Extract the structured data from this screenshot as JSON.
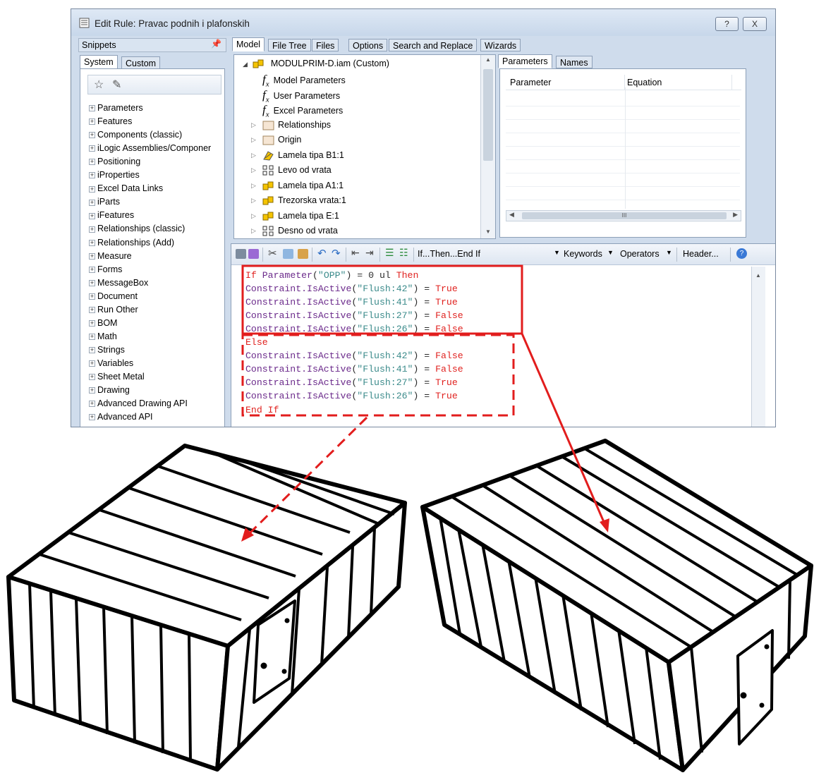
{
  "window": {
    "title": "Edit Rule: Pravac podnih i plafonskih",
    "help_label": "?",
    "close_label": "X"
  },
  "snippets": {
    "header": "Snippets",
    "pin": "ᵖ",
    "tabs": [
      "System",
      "Custom"
    ],
    "items": [
      "Parameters",
      "Features",
      "Components (classic)",
      "iLogic Assemblies/Componer",
      "Positioning",
      "iProperties",
      "Excel Data Links",
      "iParts",
      "iFeatures",
      "Relationships (classic)",
      "Relationships (Add)",
      "Measure",
      "Forms",
      "MessageBox",
      "Document",
      "Run Other",
      "BOM",
      "Math",
      "Strings",
      "Variables",
      "Sheet Metal",
      "Drawing",
      "Advanced Drawing API",
      "Advanced API"
    ]
  },
  "main_tabs": [
    "Model",
    "File Tree",
    "Files",
    "Options",
    "Search and Replace",
    "Wizards"
  ],
  "model_tree": {
    "root": "MODULPRIM-D.iam (Custom)",
    "items": [
      {
        "label": "Model Parameters",
        "icon": "fx-icon"
      },
      {
        "label": "User Parameters",
        "icon": "fx-icon"
      },
      {
        "label": "Excel Parameters",
        "icon": "fx-icon"
      },
      {
        "label": "Relationships",
        "icon": "folder-icon"
      },
      {
        "label": "Origin",
        "icon": "folder-icon"
      },
      {
        "label": "Lamela tipa B1:1",
        "icon": "part-icon"
      },
      {
        "label": "Levo od vrata",
        "icon": "pattern-icon"
      },
      {
        "label": "Lamela tipa A1:1",
        "icon": "assembly-icon"
      },
      {
        "label": "Trezorska vrata:1",
        "icon": "assembly-icon"
      },
      {
        "label": "Lamela tipa E:1",
        "icon": "assembly-icon"
      },
      {
        "label": "Desno od vrata",
        "icon": "pattern-icon"
      }
    ]
  },
  "param_tabs": [
    "Parameters",
    "Names"
  ],
  "param_columns": [
    "Parameter",
    "Equation"
  ],
  "param_scroll": "III",
  "toolbar": {
    "ifthen": "If...Then...End If",
    "keywords": "Keywords",
    "operators": "Operators",
    "header": "Header..."
  },
  "code_lines": [
    [
      [
        "kw",
        "If "
      ],
      [
        "fn",
        "Parameter"
      ],
      [
        "pl",
        "("
      ],
      [
        "str",
        "\"OPP\""
      ],
      [
        "pl",
        ") = 0 ul "
      ],
      [
        "kw",
        "Then"
      ]
    ],
    [
      [
        "fn",
        "Constraint.IsActive"
      ],
      [
        "pl",
        "("
      ],
      [
        "str",
        "\"Flush:42\""
      ],
      [
        "pl",
        ") = "
      ],
      [
        "kw",
        "True"
      ]
    ],
    [
      [
        "fn",
        "Constraint.IsActive"
      ],
      [
        "pl",
        "("
      ],
      [
        "str",
        "\"Flush:41\""
      ],
      [
        "pl",
        ") = "
      ],
      [
        "kw",
        "True"
      ]
    ],
    [
      [
        "fn",
        "Constraint.IsActive"
      ],
      [
        "pl",
        "("
      ],
      [
        "str",
        "\"Flush:27\""
      ],
      [
        "pl",
        ") = "
      ],
      [
        "kw",
        "False"
      ]
    ],
    [
      [
        "fn",
        "Constraint.IsActive"
      ],
      [
        "pl",
        "("
      ],
      [
        "str",
        "\"Flush:26\""
      ],
      [
        "pl",
        ") = "
      ],
      [
        "kw",
        "False"
      ]
    ],
    [
      [
        "kw",
        "Else"
      ]
    ],
    [
      [
        "fn",
        "Constraint.IsActive"
      ],
      [
        "pl",
        "("
      ],
      [
        "str",
        "\"Flush:42\""
      ],
      [
        "pl",
        ") = "
      ],
      [
        "kw",
        "False"
      ]
    ],
    [
      [
        "fn",
        "Constraint.IsActive"
      ],
      [
        "pl",
        "("
      ],
      [
        "str",
        "\"Flush:41\""
      ],
      [
        "pl",
        ") = "
      ],
      [
        "kw",
        "False"
      ]
    ],
    [
      [
        "fn",
        "Constraint.IsActive"
      ],
      [
        "pl",
        "("
      ],
      [
        "str",
        "\"Flush:27\""
      ],
      [
        "pl",
        ") = "
      ],
      [
        "kw",
        "True"
      ]
    ],
    [
      [
        "fn",
        "Constraint.IsActive"
      ],
      [
        "pl",
        "("
      ],
      [
        "str",
        "\"Flush:26\""
      ],
      [
        "pl",
        ") = "
      ],
      [
        "kw",
        "True"
      ]
    ],
    [
      [
        "kw",
        "End If"
      ]
    ]
  ],
  "colors": {
    "annotation": "#e21d1d",
    "keyword": "#e0221f",
    "string": "#3b8b8b",
    "function": "#6b2a8b"
  }
}
